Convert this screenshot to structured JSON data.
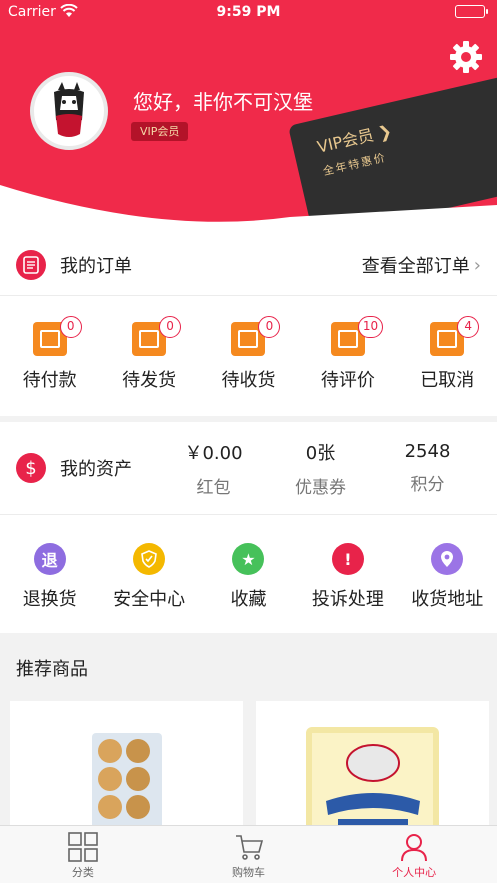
{
  "status": {
    "carrier": "Carrier",
    "time": "9:59 PM"
  },
  "profile": {
    "greeting": "您好，非你不可汉堡",
    "badge": "VIP会员"
  },
  "vip_card": {
    "title": "VIP会员",
    "subtitle": "全年特惠价"
  },
  "orders": {
    "title": "我的订单",
    "view_all": "查看全部订单",
    "items": [
      {
        "label": "待付款",
        "count": "0"
      },
      {
        "label": "待发货",
        "count": "0"
      },
      {
        "label": "待收货",
        "count": "0"
      },
      {
        "label": "待评价",
        "count": "10"
      },
      {
        "label": "已取消",
        "count": "4"
      }
    ]
  },
  "assets": {
    "title": "我的资产",
    "items": [
      {
        "value": "￥0.00",
        "label": "红包"
      },
      {
        "value": "0张",
        "label": "优惠券"
      },
      {
        "value": "2548",
        "label": "积分"
      }
    ]
  },
  "services": [
    {
      "label": "退换货",
      "icon": "return-icon",
      "glyph": "退",
      "color": "#8e6de0"
    },
    {
      "label": "安全中心",
      "icon": "shield-icon",
      "glyph": "",
      "color": "#f4b800"
    },
    {
      "label": "收藏",
      "icon": "star-icon",
      "glyph": "",
      "color": "#46c15a"
    },
    {
      "label": "投诉处理",
      "icon": "alert-icon",
      "glyph": "!",
      "color": "#e8234a"
    },
    {
      "label": "收货地址",
      "icon": "location-icon",
      "glyph": "",
      "color": "#9b74e6"
    }
  ],
  "recommend": {
    "title": "推荐商品"
  },
  "tabs": [
    {
      "label": "分类",
      "icon": "grid-icon"
    },
    {
      "label": "购物车",
      "icon": "cart-icon"
    },
    {
      "label": "个人中心",
      "icon": "person-icon"
    }
  ],
  "colors": {
    "brand": "#f02a4a",
    "accent": "#e8234a",
    "order_icon": "#f5891f"
  }
}
